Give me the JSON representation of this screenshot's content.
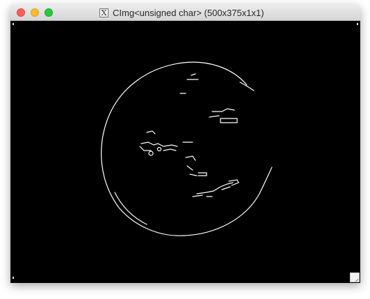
{
  "window": {
    "title": "CImg<unsigned char> (500x375x1x1)",
    "app_icon": "x11-icon",
    "app_icon_glyph": "X"
  },
  "canvas": {
    "background": "#000000",
    "edge_color": "#ffffff"
  },
  "colors": {
    "close": "#fc5f57",
    "minimize": "#fdbb2e",
    "maximize": "#28c840"
  }
}
